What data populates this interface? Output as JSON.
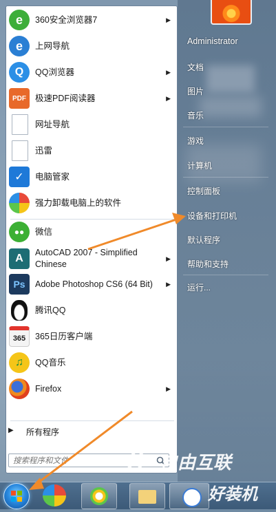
{
  "programs": [
    {
      "label": "360安全浏览器7",
      "icon": "360-browser-icon",
      "color": "#3dae3a",
      "glyph": "e",
      "submenu": true
    },
    {
      "label": "上网导航",
      "icon": "ie-icon",
      "color": "#2a7fd4",
      "glyph": "e",
      "submenu": false
    },
    {
      "label": "QQ浏览器",
      "icon": "qq-browser-icon",
      "color": "#2b8fe6",
      "glyph": "Q",
      "submenu": true
    },
    {
      "label": "极速PDF阅读器",
      "icon": "pdf-reader-icon",
      "color": "#e8692a",
      "glyph": "PDF",
      "submenu": true
    },
    {
      "label": "网址导航",
      "icon": "document-icon",
      "color": "#ffffff",
      "glyph": "",
      "submenu": false
    },
    {
      "label": "迅雷",
      "icon": "document-icon",
      "color": "#ffffff",
      "glyph": "",
      "submenu": false
    },
    {
      "label": "电脑管家",
      "icon": "pc-manager-icon",
      "color": "#1e79d8",
      "glyph": "✓",
      "submenu": false
    },
    {
      "label": "强力卸载电脑上的软件",
      "icon": "uninstall-icon",
      "color": "#5cc64a",
      "glyph": "✿",
      "submenu": false
    },
    {
      "label": "微信",
      "icon": "wechat-icon",
      "color": "#3cb034",
      "glyph": "●",
      "submenu": false
    },
    {
      "label": "AutoCAD 2007 - Simplified Chinese",
      "label_line1": "AutoCAD 2007 - Simplified",
      "label_line2": "Chinese",
      "icon": "autocad-icon",
      "color": "#1d6d74",
      "glyph": "A",
      "submenu": true
    },
    {
      "label": "Adobe Photoshop CS6 (64 Bit)",
      "icon": "photoshop-icon",
      "color": "#1c3a5e",
      "glyph": "Ps",
      "submenu": true
    },
    {
      "label": "腾讯QQ",
      "icon": "qq-penguin-icon",
      "color": "#222222",
      "glyph": "●",
      "submenu": false
    },
    {
      "label": "365日历客户端",
      "icon": "calendar-365-icon",
      "color": "#eeeeee",
      "glyph": "365",
      "submenu": false
    },
    {
      "label": "QQ音乐",
      "icon": "qq-music-icon",
      "color": "#f5c518",
      "glyph": "♫",
      "submenu": false
    },
    {
      "label": "Firefox",
      "icon": "firefox-icon",
      "color": "#e66a1e",
      "glyph": "●",
      "submenu": true
    }
  ],
  "all_programs_label": "所有程序",
  "search": {
    "placeholder": "搜索程序和文件"
  },
  "right_menu": {
    "user": "Administrator",
    "items": [
      "文档",
      "图片",
      "音乐",
      "游戏",
      "计算机",
      "控制面板",
      "设备和打印机",
      "默认程序",
      "帮助和支持",
      "运行..."
    ]
  },
  "watermark": {
    "text1": "自由互联",
    "text2": "好装机"
  },
  "colors": {
    "annotation_arrow": "#f08a2a",
    "left_pane": "#ffffff",
    "taskbar": "#3c5a78"
  }
}
